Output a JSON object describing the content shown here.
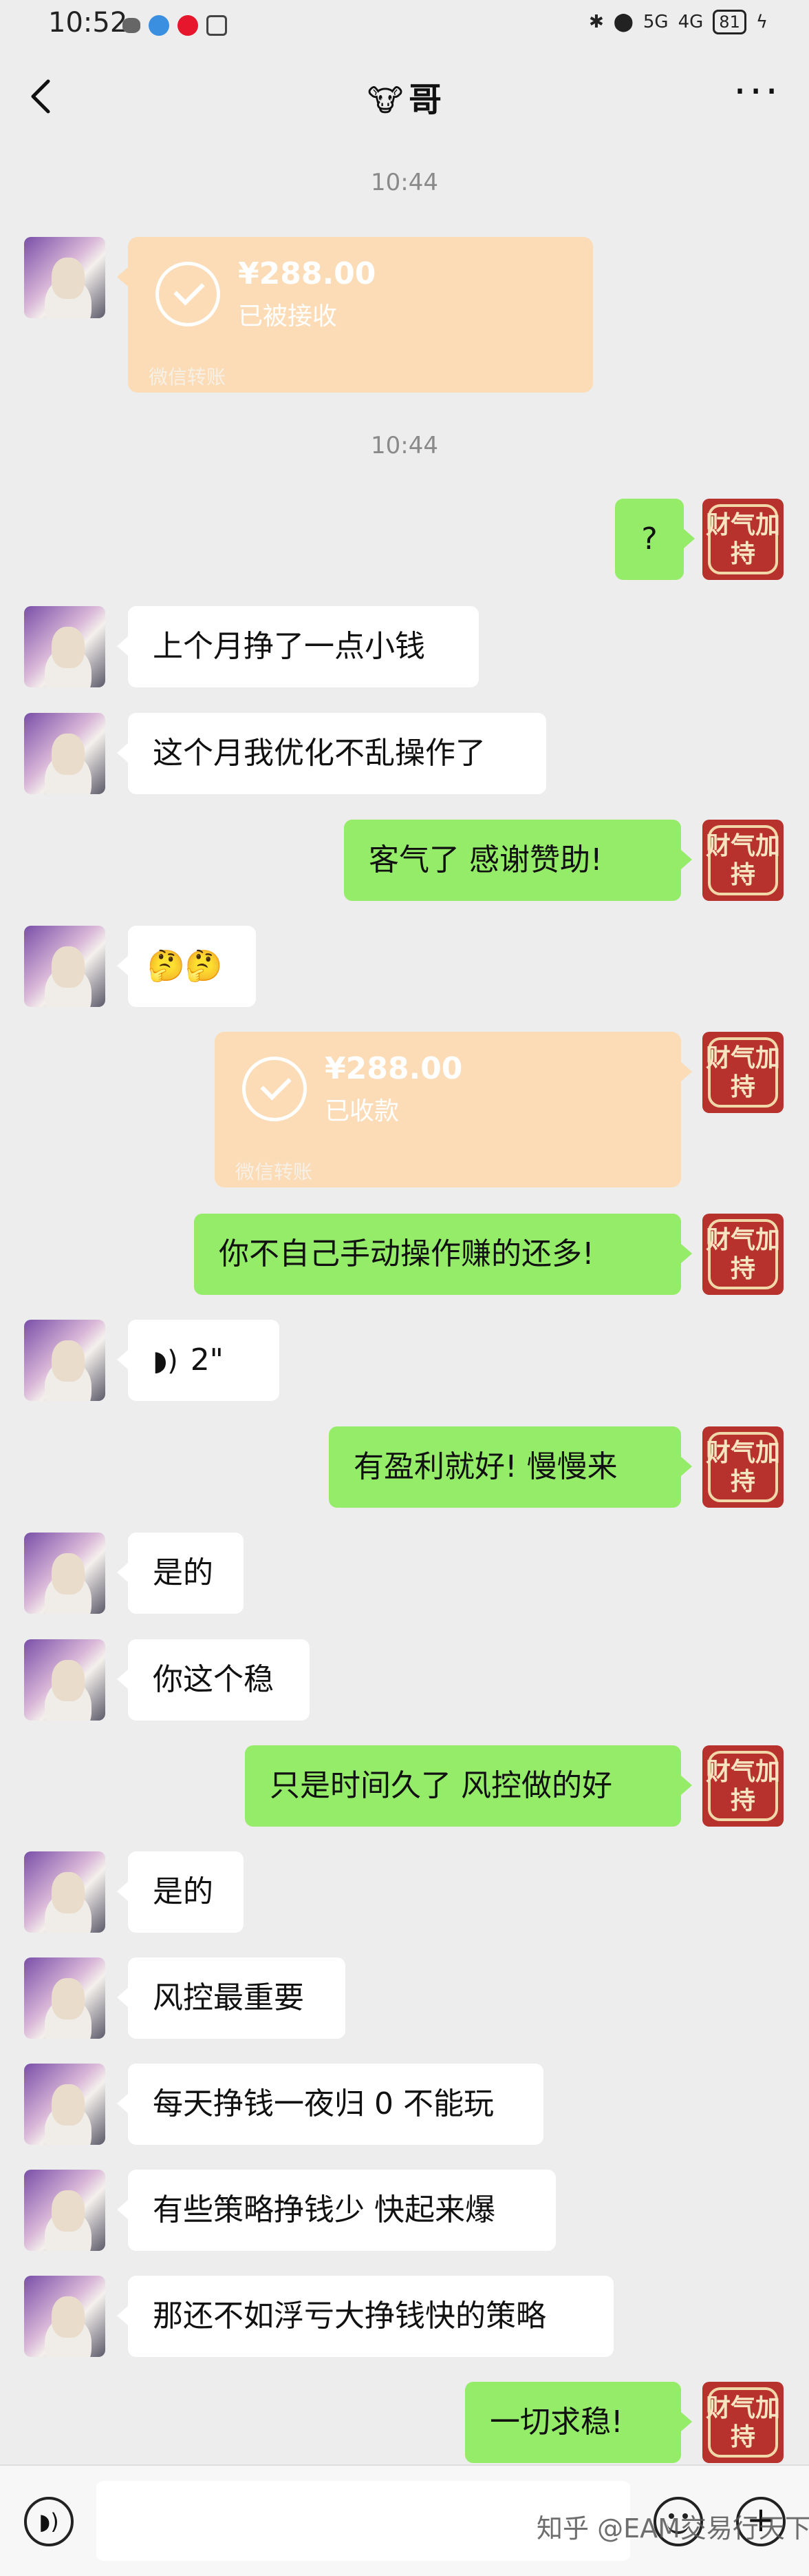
{
  "status_bar": {
    "time": "10:52",
    "signal_1": "5G",
    "signal_2": "4G",
    "battery": "81"
  },
  "header": {
    "title": "哥",
    "title_emoji": "🐮"
  },
  "timestamps": [
    "10:44",
    "10:44"
  ],
  "avatar_right_text": "财气加持",
  "messages": [
    {
      "side": "left",
      "type": "transfer",
      "amount": "¥288.00",
      "status": "已被接收",
      "source": "微信转账"
    },
    {
      "side": "right",
      "type": "text",
      "text": "?"
    },
    {
      "side": "left",
      "type": "text",
      "text": "上个月挣了一点小钱"
    },
    {
      "side": "left",
      "type": "text",
      "text": "这个月我优化不乱操作了"
    },
    {
      "side": "right",
      "type": "text",
      "text": "客气了  感谢赞助!"
    },
    {
      "side": "left",
      "type": "text",
      "text": "🤔🤔"
    },
    {
      "side": "right",
      "type": "transfer",
      "amount": "¥288.00",
      "status": "已收款",
      "source": "微信转账"
    },
    {
      "side": "right",
      "type": "text",
      "text": "你不自己手动操作赚的还多!"
    },
    {
      "side": "left",
      "type": "voice",
      "text": "2\""
    },
    {
      "side": "right",
      "type": "text",
      "text": "有盈利就好!  慢慢来"
    },
    {
      "side": "left",
      "type": "text",
      "text": "是的"
    },
    {
      "side": "left",
      "type": "text",
      "text": "你这个稳"
    },
    {
      "side": "right",
      "type": "text",
      "text": "只是时间久了  风控做的好"
    },
    {
      "side": "left",
      "type": "text",
      "text": "是的"
    },
    {
      "side": "left",
      "type": "text",
      "text": "风控最重要"
    },
    {
      "side": "left",
      "type": "text",
      "text": "每天挣钱一夜归 0 不能玩"
    },
    {
      "side": "left",
      "type": "text",
      "text": "有些策略挣钱少 快起来爆"
    },
    {
      "side": "left",
      "type": "text",
      "text": "那还不如浮亏大挣钱快的策略"
    },
    {
      "side": "right",
      "type": "text",
      "text": "一切求稳!"
    }
  ],
  "watermark": "知乎 @EAM交易行天下",
  "colors": {
    "background": "#ededed",
    "bubble_sent": "#95ec69",
    "bubble_received": "#ffffff",
    "transfer_card": "#fbdcb6"
  }
}
